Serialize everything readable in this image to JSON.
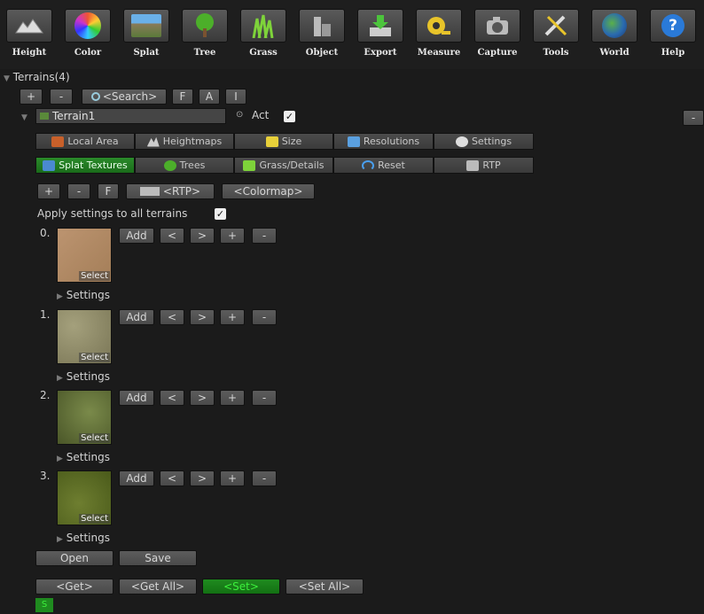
{
  "toolbar": {
    "items": [
      {
        "label": "Height",
        "icon": "height-mountains-icon"
      },
      {
        "label": "Color",
        "icon": "color-wheel-icon"
      },
      {
        "label": "Splat",
        "icon": "splat-landscape-icon"
      },
      {
        "label": "Tree",
        "icon": "tree-icon"
      },
      {
        "label": "Grass",
        "icon": "grass-icon"
      },
      {
        "label": "Object",
        "icon": "object-buildings-icon"
      },
      {
        "label": "Export",
        "icon": "export-download-icon"
      },
      {
        "label": "Measure",
        "icon": "measure-tape-icon"
      },
      {
        "label": "Capture",
        "icon": "capture-camera-icon"
      },
      {
        "label": "Tools",
        "icon": "tools-wrench-icon"
      },
      {
        "label": "World",
        "icon": "world-globe-icon"
      },
      {
        "label": "Help",
        "icon": "help-question-icon"
      }
    ]
  },
  "terrains": {
    "header": "Terrains(4)",
    "buttons": {
      "add": "+",
      "remove": "-",
      "search": "<Search>",
      "f": "F",
      "a": "A",
      "i": "I"
    },
    "terrain_name": "Terrain1",
    "act_label": "Act",
    "act_checked": "✓",
    "side_button": "-"
  },
  "tabs_row1": [
    {
      "label": "Local Area",
      "icon": "local-area-icon"
    },
    {
      "label": "Heightmaps",
      "icon": "heightmaps-icon"
    },
    {
      "label": "Size",
      "icon": "size-icon"
    },
    {
      "label": "Resolutions",
      "icon": "resolutions-icon"
    },
    {
      "label": "Settings",
      "icon": "settings-gear-icon"
    }
  ],
  "tabs_row2": [
    {
      "label": "Splat Textures",
      "icon": "splat-textures-icon",
      "active": true
    },
    {
      "label": "Trees",
      "icon": "trees-icon"
    },
    {
      "label": "Grass/Details",
      "icon": "grass-details-icon"
    },
    {
      "label": "Reset",
      "icon": "reset-icon"
    },
    {
      "label": "RTP",
      "icon": "rtp-icon"
    }
  ],
  "splat": {
    "buttons": {
      "add": "+",
      "remove": "-",
      "f": "F",
      "rtp": "<RTP>",
      "colormap": "<Colormap>"
    },
    "apply_all_label": "Apply settings to all terrains",
    "apply_all_checked": "✓",
    "textures": [
      {
        "index": "0.",
        "select": "Select",
        "settings": "Settings",
        "color": "#b08a64"
      },
      {
        "index": "1.",
        "select": "Select",
        "settings": "Settings",
        "color": "#8b8869"
      },
      {
        "index": "2.",
        "select": "Select",
        "settings": "Settings",
        "color": "#5d6838"
      },
      {
        "index": "3.",
        "select": "Select",
        "settings": "Settings",
        "color": "#5b6a25"
      }
    ],
    "row_buttons": {
      "add": "Add",
      "left": "<",
      "right": ">",
      "plus": "+",
      "minus": "-"
    }
  },
  "footer": {
    "open": "Open",
    "save": "Save",
    "get": "<Get>",
    "get_all": "<Get All>",
    "set": "<Set>",
    "set_all": "<Set All>",
    "s": "S"
  },
  "colors": {
    "active_green": "#1a7a1a",
    "background": "#1b1b1b"
  }
}
